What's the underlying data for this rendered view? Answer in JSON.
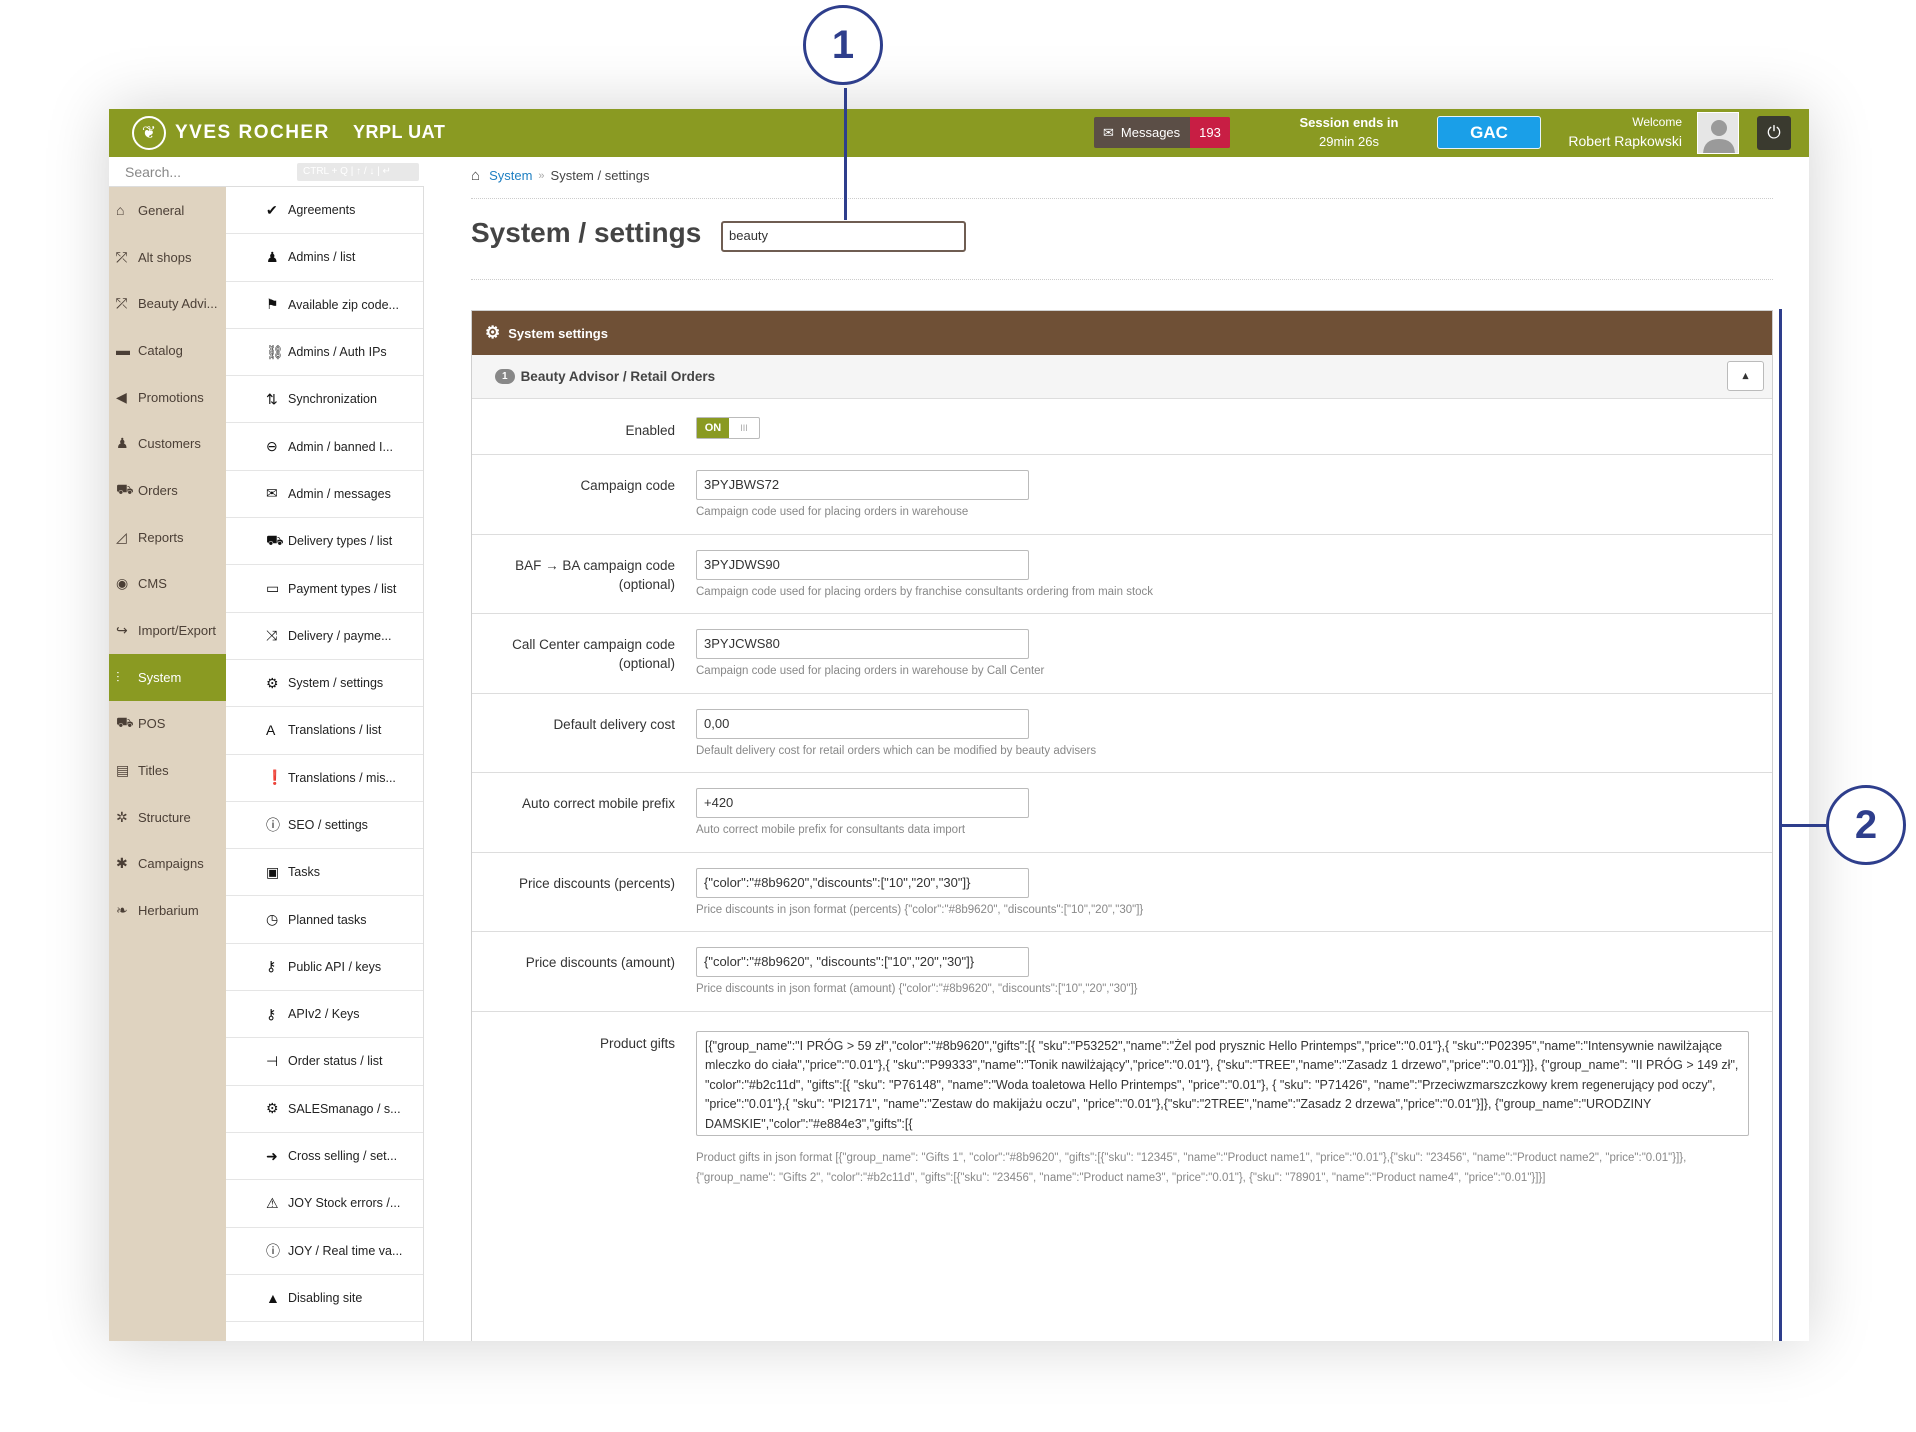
{
  "header": {
    "brand": "YVES ROCHER",
    "env": "YRPL UAT",
    "messages_label": "Messages",
    "messages_count": "193",
    "session_title": "Session ends in",
    "session_time": "29min 26s",
    "gac_label": "GAC",
    "welcome_label": "Welcome",
    "user_name": "Robert Rapkowski"
  },
  "search": {
    "placeholder": "Search...",
    "shortcut": "CTRL + Q | ↑ / ↓ | ↵"
  },
  "nav1": [
    {
      "label": "General",
      "icon": "home-icon"
    },
    {
      "label": "Alt shops",
      "icon": "share-icon"
    },
    {
      "label": "Beauty Advi...",
      "icon": "share-icon"
    },
    {
      "label": "Catalog",
      "icon": "folder-icon"
    },
    {
      "label": "Promotions",
      "icon": "bullhorn-icon"
    },
    {
      "label": "Customers",
      "icon": "users-icon"
    },
    {
      "label": "Orders",
      "icon": "cart-icon"
    },
    {
      "label": "Reports",
      "icon": "chart-icon"
    },
    {
      "label": "CMS",
      "icon": "globe-icon"
    },
    {
      "label": "Import/Export",
      "icon": "share-arrow-icon"
    },
    {
      "label": "System",
      "icon": "sliders-icon"
    },
    {
      "label": "POS",
      "icon": "cart-icon"
    },
    {
      "label": "Titles",
      "icon": "list-icon"
    },
    {
      "label": "Structure",
      "icon": "cog-icon"
    },
    {
      "label": "Campaigns",
      "icon": "asterisk-icon"
    },
    {
      "label": "Herbarium",
      "icon": "leaf-icon"
    }
  ],
  "nav2": [
    {
      "label": "Agreements",
      "icon": "check-icon"
    },
    {
      "label": "Admins / list",
      "icon": "user-icon"
    },
    {
      "label": "Available zip code...",
      "icon": "flag-icon"
    },
    {
      "label": "Admins / Auth IPs",
      "icon": "link-icon"
    },
    {
      "label": "Synchronization",
      "icon": "sync-icon"
    },
    {
      "label": "Admin / banned I...",
      "icon": "minus-circle-icon"
    },
    {
      "label": "Admin / messages",
      "icon": "envelope-icon"
    },
    {
      "label": "Delivery types / list",
      "icon": "truck-icon"
    },
    {
      "label": "Payment types / list",
      "icon": "money-icon"
    },
    {
      "label": "Delivery / payme...",
      "icon": "shuffle-icon"
    },
    {
      "label": "System / settings",
      "icon": "gear-icon"
    },
    {
      "label": "Translations / list",
      "icon": "font-icon"
    },
    {
      "label": "Translations / mis...",
      "icon": "exclamation-icon"
    },
    {
      "label": "SEO / settings",
      "icon": "info-icon"
    },
    {
      "label": "Tasks",
      "icon": "clipboard-icon"
    },
    {
      "label": "Planned tasks",
      "icon": "clock-icon"
    },
    {
      "label": "Public API / keys",
      "icon": "key-search-icon"
    },
    {
      "label": "APIv2 / Keys",
      "icon": "key-icon"
    },
    {
      "label": "Order status / list",
      "icon": "signpost-icon"
    },
    {
      "label": "SALESmanago / s...",
      "icon": "gear-icon"
    },
    {
      "label": "Cross selling / set...",
      "icon": "arrow-right-icon"
    },
    {
      "label": "JOY Stock errors /...",
      "icon": "warning-icon"
    },
    {
      "label": "JOY / Real time va...",
      "icon": "info-icon"
    },
    {
      "label": "Disabling site",
      "icon": "lock-icon"
    }
  ],
  "breadcrumb": {
    "link": "System",
    "current": "System / settings"
  },
  "page": {
    "title": "System / settings",
    "filter_value": "beauty"
  },
  "panel": {
    "title": "System settings",
    "section_num": "1",
    "section_title": "Beauty Advisor / Retail Orders",
    "enabled_label": "Enabled",
    "toggle_on": "ON",
    "toggle_off": "III",
    "fields": [
      {
        "label": "Campaign code",
        "label2": "",
        "value": "3PYJBWS72",
        "help": "Campaign code used for placing orders in warehouse"
      },
      {
        "label": "BAF → BA campaign code",
        "label2": "(optional)",
        "value": "3PYJDWS90",
        "help": "Campaign code used for placing orders by franchise consultants ordering from main stock"
      },
      {
        "label": "Call Center campaign code",
        "label2": "(optional)",
        "value": "3PYJCWS80",
        "help": "Campaign code used for placing orders in warehouse by Call Center"
      },
      {
        "label": "Default delivery cost",
        "label2": "",
        "value": "0,00",
        "help": "Default delivery cost for retail orders which can be modified by beauty advisers"
      },
      {
        "label": "Auto correct mobile prefix",
        "label2": "",
        "value": "+420",
        "help": "Auto correct mobile prefix for consultants data import"
      },
      {
        "label": "Price discounts (percents)",
        "label2": "",
        "value": "{\"color\":\"#8b9620\",\"discounts\":[\"10\",\"20\",\"30\"]}",
        "help": "Price discounts in json format (percents) {\"color\":\"#8b9620\", \"discounts\":[\"10\",\"20\",\"30\"]}"
      },
      {
        "label": "Price discounts (amount)",
        "label2": "",
        "value": "{\"color\":\"#8b9620\", \"discounts\":[\"10\",\"20\",\"30\"]}",
        "help": "Price discounts in json format (amount) {\"color\":\"#8b9620\", \"discounts\":[\"10\",\"20\",\"30\"]}"
      }
    ],
    "gifts_label": "Product gifts",
    "gifts_value": "[{\"group_name\":\"I PRÓG > 59 zł\",\"color\":\"#8b9620\",\"gifts\":[{ \"sku\":\"P53252\",\"name\":\"Żel pod prysznic Hello Printemps\",\"price\":\"0.01\"},{ \"sku\":\"P02395\",\"name\":\"Intensywnie nawilżające mleczko do ciała\",\"price\":\"0.01\"},{ \"sku\":\"P99333\",\"name\":\"Tonik nawilżający\",\"price\":\"0.01\"}, {\"sku\":\"TREE\",\"name\":\"Zasadz 1 drzewo\",\"price\":\"0.01\"}]},  {\"group_name\": \"II PRÓG > 149 zł\", \"color\":\"#b2c11d\", \"gifts\":[{ \"sku\": \"P76148\", \"name\":\"Woda toaletowa Hello Printemps\", \"price\":\"0.01\"}, { \"sku\": \"P71426\", \"name\":\"Przeciwzmarszczkowy krem regenerujący pod oczy\", \"price\":\"0.01\"},{ \"sku\": \"PI2171\", \"name\":\"Zestaw do makijażu oczu\", \"price\":\"0.01\"},{\"sku\":\"2TREE\",\"name\":\"Zasadz 2 drzewa\",\"price\":\"0.01\"}]}, {\"group_name\":\"URODZINY DAMSKIE\",\"color\":\"#e884e3\",\"gifts\":[{",
    "gifts_help": "Product gifts in json format [{\"group_name\": \"Gifts 1\", \"color\":\"#8b9620\", \"gifts\":[{\"sku\": \"12345\", \"name\":\"Product name1\", \"price\":\"0.01\"},{\"sku\": \"23456\", \"name\":\"Product name2\", \"price\":\"0.01\"}]}, {\"group_name\": \"Gifts 2\", \"color\":\"#b2c11d\", \"gifts\":[{\"sku\": \"23456\", \"name\":\"Product name3\", \"price\":\"0.01\"}, {\"sku\": \"78901\", \"name\":\"Product name4\", \"price\":\"0.01\"}]}]"
  },
  "callouts": [
    "1",
    "2"
  ],
  "colors": {
    "brand_green": "#8a9a22",
    "panel_brown": "#6f5036",
    "sidebar_beige": "#dfd3c0",
    "badge_red": "#c81e44",
    "gac_blue": "#1a9fe8",
    "callout_blue": "#2e3e8c"
  }
}
